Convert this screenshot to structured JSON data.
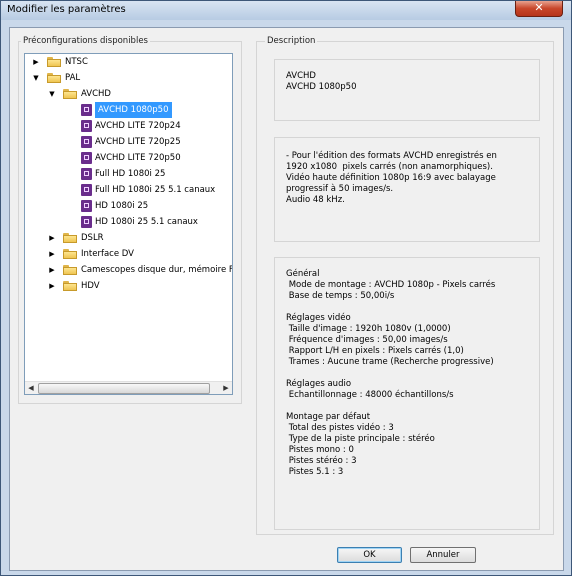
{
  "window": {
    "title": "Modifier les paramètres",
    "close_glyph": "✕"
  },
  "left_group": {
    "label": "Préconfigurations disponibles"
  },
  "tree": [
    {
      "label": "NTSC",
      "type": "folder",
      "level": 0,
      "arrow": "▶"
    },
    {
      "label": "PAL",
      "type": "folder",
      "level": 0,
      "arrow": "▼"
    },
    {
      "label": "AVCHD",
      "type": "folder",
      "level": 1,
      "arrow": "▼"
    },
    {
      "label": "AVCHD 1080p50",
      "type": "preset",
      "level": 2,
      "selected": true
    },
    {
      "label": "AVCHD LITE 720p24",
      "type": "preset",
      "level": 2
    },
    {
      "label": "AVCHD LITE 720p25",
      "type": "preset",
      "level": 2
    },
    {
      "label": "AVCHD LITE 720p50",
      "type": "preset",
      "level": 2
    },
    {
      "label": "Full HD 1080i 25",
      "type": "preset",
      "level": 2
    },
    {
      "label": "Full HD 1080i 25 5.1 canaux",
      "type": "preset",
      "level": 2
    },
    {
      "label": "HD 1080i 25",
      "type": "preset",
      "level": 2
    },
    {
      "label": "HD 1080i 25 5.1 canaux",
      "type": "preset",
      "level": 2
    },
    {
      "label": "DSLR",
      "type": "folder",
      "level": 1,
      "arrow": "▶"
    },
    {
      "label": "Interface DV",
      "type": "folder",
      "level": 1,
      "arrow": "▶"
    },
    {
      "label": "Camescopes disque dur, mémoire FL",
      "type": "folder",
      "level": 1,
      "arrow": "▶"
    },
    {
      "label": "HDV",
      "type": "folder",
      "level": 1,
      "arrow": "▶"
    }
  ],
  "scroll": {
    "left": "◀",
    "right": "▶"
  },
  "right_group": {
    "label": "Description"
  },
  "panels": {
    "name": [
      "AVCHD",
      "AVCHD 1080p50"
    ],
    "description": [
      "- Pour l'édition des formats AVCHD enregistrés en",
      "1920 x1080  pixels carrés (non anamorphiques).",
      "Vidéo haute définition 1080p 16:9 avec balayage",
      "progressif à 50 images/s.",
      "Audio 48 kHz."
    ],
    "details": [
      "Général",
      " Mode de montage : AVCHD 1080p - Pixels carrés",
      " Base de temps : 50,00i/s",
      "",
      "Réglages vidéo",
      " Taille d'image : 1920h 1080v (1,0000)",
      " Fréquence d'images : 50,00 images/s",
      " Rapport L/H en pixels : Pixels carrés (1,0)",
      " Trames : Aucune trame (Recherche progressive)",
      "",
      "Réglages audio",
      " Echantillonnage : 48000 échantillons/s",
      "",
      "Montage par défaut",
      " Total des pistes vidéo : 3",
      " Type de la piste principale : stéréo",
      " Pistes mono : 0",
      " Pistes stéréo : 3",
      " Pistes 5.1 : 3"
    ]
  },
  "buttons": {
    "ok": "OK",
    "cancel": "Annuler"
  }
}
